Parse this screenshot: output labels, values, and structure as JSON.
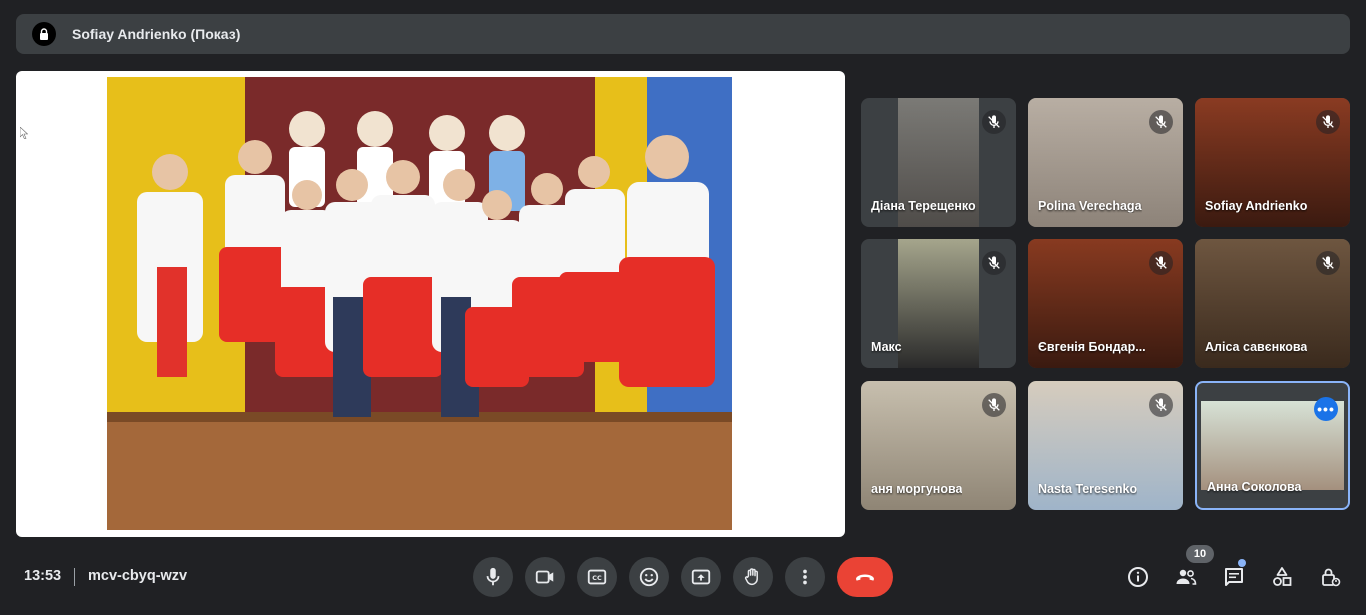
{
  "banner": {
    "title": "Sofiay Andrienko (Показ)"
  },
  "participants": [
    {
      "name": "Діана Терещенко",
      "bg": "#6b6a66",
      "active": false
    },
    {
      "name": "Polina Verechaga",
      "bg": "#a59d93",
      "active": false
    },
    {
      "name": "Sofiay Andrienko",
      "bg": "#6d2a1a",
      "active": false
    },
    {
      "name": "Макс",
      "bg": "#8c8c7a",
      "active": false
    },
    {
      "name": "Євгенія Бондар...",
      "bg": "#6a2a18",
      "active": false
    },
    {
      "name": "Аліса савєнкова",
      "bg": "#5a4330",
      "active": false
    },
    {
      "name": "аня моргунова",
      "bg": "#b7ad9a",
      "active": false
    },
    {
      "name": "Nasta Teresenko",
      "bg": "#c9bfae",
      "active": false
    },
    {
      "name": "Анна Соколова",
      "bg": "#c6d2c6",
      "active": true
    }
  ],
  "bottom": {
    "time": "13:53",
    "meeting_code": "mcv-cbyq-wzv",
    "participant_count": "10"
  },
  "colors": {
    "accent": "#8ab4f8",
    "hangup": "#ea4335",
    "bar": "#202124",
    "control": "#3c4043"
  }
}
